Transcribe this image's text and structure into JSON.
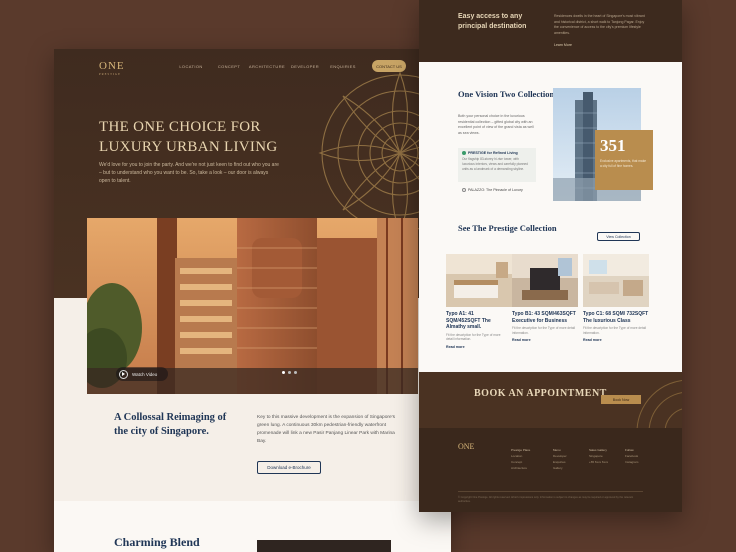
{
  "left": {
    "logo": "ONE",
    "logo_sub": "PRESTIGE",
    "nav": [
      "LOCATION",
      "CONCEPT",
      "ARCHITECTURE",
      "DEVELOPER",
      "ENQUIRIES"
    ],
    "contact": "CONTACT US",
    "hero_title": "THE ONE CHOICE FOR LUXURY URBAN LIVING",
    "hero_sub": "We'd love for you to join the party. And we're not just keen to find out who you are – but to understand who you want to be. So, take a look – our door is always open to talent.",
    "watch_video": "Watch Video",
    "collossal_title": "A Collossal Reimaging of the city of Singapore.",
    "collossal_text": "Key to this massive development is the expansion of Singapore's green lung. A continuous 30km pedestrian-friendly waterfront promenade will link a new Pasir Panjang Linear Park with Marina Bay.",
    "brochure": "Download e-Brochure",
    "charming": "Charming Blend"
  },
  "right": {
    "access_title": "Easy access to any principal destination",
    "access_text": "Residences dwells in the heart of Singapore's most vibrant and historical district, a short walk to Tanjong Pagar. Enjoy the convenience of access to the city's premium lifestyle amenities.",
    "learn_more": "Learn More",
    "vision_title": "One Vision Two Collection",
    "vision_text": "Both your personal choice in the luxurious residential collection – gifted global city with an excellent point of view of the grand vista as well as sea views.",
    "prestige_card_title": "PRESTIGE for Refined Living",
    "prestige_card_text": "Our flagship 83-storey hi-rise tower, with luxurious interiors, views and carefully planned units as a landmark of a demanding skyline.",
    "palazzo": "PALAZZO: The Pinnacle of Luxury",
    "stat_number": "351",
    "stat_text": "Exclusive apartments, that make a city full of fine homes.",
    "see_prestige": "See The Prestige Collection",
    "view_all": "View Collection",
    "cards": [
      {
        "title": "Typo A1: 41 SQM/452SQFT The Almathy small.",
        "text": "Fit the description for the Type of more detail information.",
        "link": "Read more"
      },
      {
        "title": "Typo B1: 43 SQM/463SQFT Executive for Business",
        "text": "Fit the description for the Type of more detail information.",
        "link": "Read more"
      },
      {
        "title": "Typo C1: 68 SQM/ 732SQFT The luxurious Class",
        "text": "Fit the description for the Type of more detail information.",
        "link": "Read more"
      }
    ],
    "book_title": "BOOK AN APPOINTMENT",
    "book_btn": "Book Now",
    "footer_logo": "ONE",
    "footer_cols": [
      {
        "head": "Prestige Place",
        "items": [
          "Location",
          "Concept",
          "Architecture"
        ]
      },
      {
        "head": "Menu",
        "items": [
          "Developer",
          "Enquiries",
          "Gallery"
        ]
      },
      {
        "head": "Sales Gallery",
        "items": [
          "Singapore",
          "+65 6xxx 6xxx"
        ]
      },
      {
        "head": "Follow",
        "items": [
          "Facebook",
          "Instagram"
        ]
      }
    ],
    "copyright": "© Copyright One Prestige. All rights reserved. Artist's impressions only. Information is subject to changes as may be required or approved by the relevant authorities."
  },
  "colors": {
    "brown_dark": "#3f2b1f",
    "gold": "#c8a465",
    "navy": "#203656",
    "cream": "#f5efe8"
  }
}
